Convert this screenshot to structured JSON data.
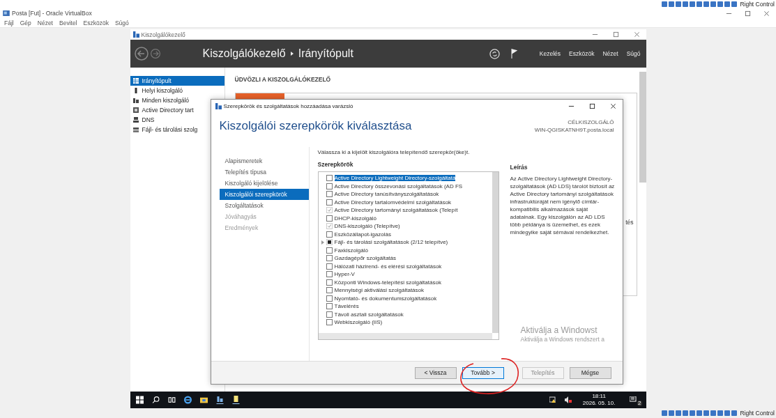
{
  "top_status": {
    "label": "Right Control"
  },
  "vbox": {
    "title": "Posta [Fut] - Oracle VirtualBox",
    "menu": [
      "Fájl",
      "Gép",
      "Nézet",
      "Bevitel",
      "Eszközök",
      "Súgó"
    ]
  },
  "server_manager": {
    "title": "Kiszolgálókezelő",
    "breadcrumb": [
      "Kiszolgálókezelő",
      "Irányítópult"
    ],
    "menu": [
      "Kezelés",
      "Eszközök",
      "Nézet",
      "Súgó"
    ],
    "nav": [
      {
        "label": "Irányítópult",
        "selected": true,
        "kind": "dashboard"
      },
      {
        "label": "Helyi kiszolgáló",
        "selected": false,
        "kind": "server"
      },
      {
        "label": "Minden kiszolgáló",
        "selected": false,
        "kind": "servers"
      },
      {
        "label": "Active Directory tart",
        "selected": false,
        "kind": "directory"
      },
      {
        "label": "DNS",
        "selected": false,
        "kind": "dns"
      },
      {
        "label": "Fájl- és tárolási szolg",
        "selected": false,
        "kind": "storage"
      }
    ],
    "welcome": "ÜDVÖZLI A KISZOLGÁLÓKEZELŐ",
    "tile_text": "tés"
  },
  "wizard": {
    "title": "Szerepkörök és szolgáltatások hozzáadása varázsló",
    "heading": "Kiszolgálói szerepkörök kiválasztása",
    "target_label": "CÉLKISZOLGÁLÓ",
    "target_server": "WIN-QGISKATNH9T.posta.local",
    "steps": [
      {
        "label": "Alapismeretek",
        "selected": false,
        "disabled": false
      },
      {
        "label": "Telepítés típusa",
        "selected": false,
        "disabled": false
      },
      {
        "label": "Kiszolgáló kijelölése",
        "selected": false,
        "disabled": false
      },
      {
        "label": "Kiszolgálói szerepkörök",
        "selected": true,
        "disabled": false
      },
      {
        "label": "Szolgáltatások",
        "selected": false,
        "disabled": false
      },
      {
        "label": "Jóváhagyás",
        "selected": false,
        "disabled": true
      },
      {
        "label": "Eredmények",
        "selected": false,
        "disabled": true
      }
    ],
    "instruction": "Válassza ki a kijelölt kiszolgálóra telepítendő szerepkör(öke)t.",
    "roles_heading": "Szerepkörök",
    "roles": [
      {
        "label": "Active Directory Lightweight Directory-szolgáltatá",
        "checked": false,
        "partial": false,
        "selected": true,
        "expandable": false
      },
      {
        "label": "Active Directory összevonási szolgáltatások (AD FS",
        "checked": false,
        "partial": false,
        "selected": false,
        "expandable": false
      },
      {
        "label": "Active Directory tanúsítványszolgáltatások",
        "checked": false,
        "partial": false,
        "selected": false,
        "expandable": false
      },
      {
        "label": "Active Directory tartalomvédelmi szolgáltatások",
        "checked": false,
        "partial": false,
        "selected": false,
        "expandable": false
      },
      {
        "label": "Active Directory tartományi szolgáltatások (Telepít",
        "checked": true,
        "partial": false,
        "selected": false,
        "expandable": false
      },
      {
        "label": "DHCP-kiszolgáló",
        "checked": false,
        "partial": false,
        "selected": false,
        "expandable": false
      },
      {
        "label": "DNS-kiszolgáló (Telepítve)",
        "checked": true,
        "partial": false,
        "selected": false,
        "expandable": false
      },
      {
        "label": "Eszközállapot-igazolás",
        "checked": false,
        "partial": false,
        "selected": false,
        "expandable": false
      },
      {
        "label": "Fájl- és tárolási szolgáltatások (2/12 telepítve)",
        "checked": true,
        "partial": true,
        "selected": false,
        "expandable": true
      },
      {
        "label": "Faxkiszolgáló",
        "checked": false,
        "partial": false,
        "selected": false,
        "expandable": false
      },
      {
        "label": "Gazdagépőr szolgáltatás",
        "checked": false,
        "partial": false,
        "selected": false,
        "expandable": false
      },
      {
        "label": "Hálózati házirend- és elérési szolgáltatások",
        "checked": false,
        "partial": false,
        "selected": false,
        "expandable": false
      },
      {
        "label": "Hyper-V",
        "checked": false,
        "partial": false,
        "selected": false,
        "expandable": false
      },
      {
        "label": "Központi Windows-telepítési szolgáltatások",
        "checked": false,
        "partial": false,
        "selected": false,
        "expandable": false
      },
      {
        "label": "Mennyiségi aktiválási szolgáltatások",
        "checked": false,
        "partial": false,
        "selected": false,
        "expandable": false
      },
      {
        "label": "Nyomtató- és dokumentumszolgáltatások",
        "checked": false,
        "partial": false,
        "selected": false,
        "expandable": false
      },
      {
        "label": "Távelérés",
        "checked": false,
        "partial": false,
        "selected": false,
        "expandable": false
      },
      {
        "label": "Távoli asztali szolgáltatások",
        "checked": false,
        "partial": false,
        "selected": false,
        "expandable": false
      },
      {
        "label": "Webkiszolgáló (IIS)",
        "checked": false,
        "partial": false,
        "selected": false,
        "expandable": false
      }
    ],
    "description_heading": "Leírás",
    "description": "Az Active Directory Lightweight Directory-szolgáltatások (AD LDS) tárolót biztosít az Active Directory tartományi szolgáltatások infrastruktúráját nem igénylő címtár-kompatibilis alkalmazások saját adatainak. Egy kiszolgálón az AD LDS több példánya is üzemelhet, és ezek mindegyike saját sémával rendelkezhet.",
    "buttons": [
      {
        "label": "< Vissza",
        "disabled": false,
        "focused": false
      },
      {
        "label": "Tovább >",
        "disabled": false,
        "focused": true
      },
      {
        "label": "Telepítés",
        "disabled": true,
        "focused": false
      },
      {
        "label": "Mégse",
        "disabled": false,
        "focused": false
      }
    ]
  },
  "activation": [
    "Aktiválja a Windowst",
    "Aktiválja a Windows rendszert a"
  ],
  "taskbar": {
    "time": "18:11",
    "date": "2026. 05. 10.",
    "notification_count": "2"
  },
  "bottom_status": {
    "label": "Right Control"
  }
}
